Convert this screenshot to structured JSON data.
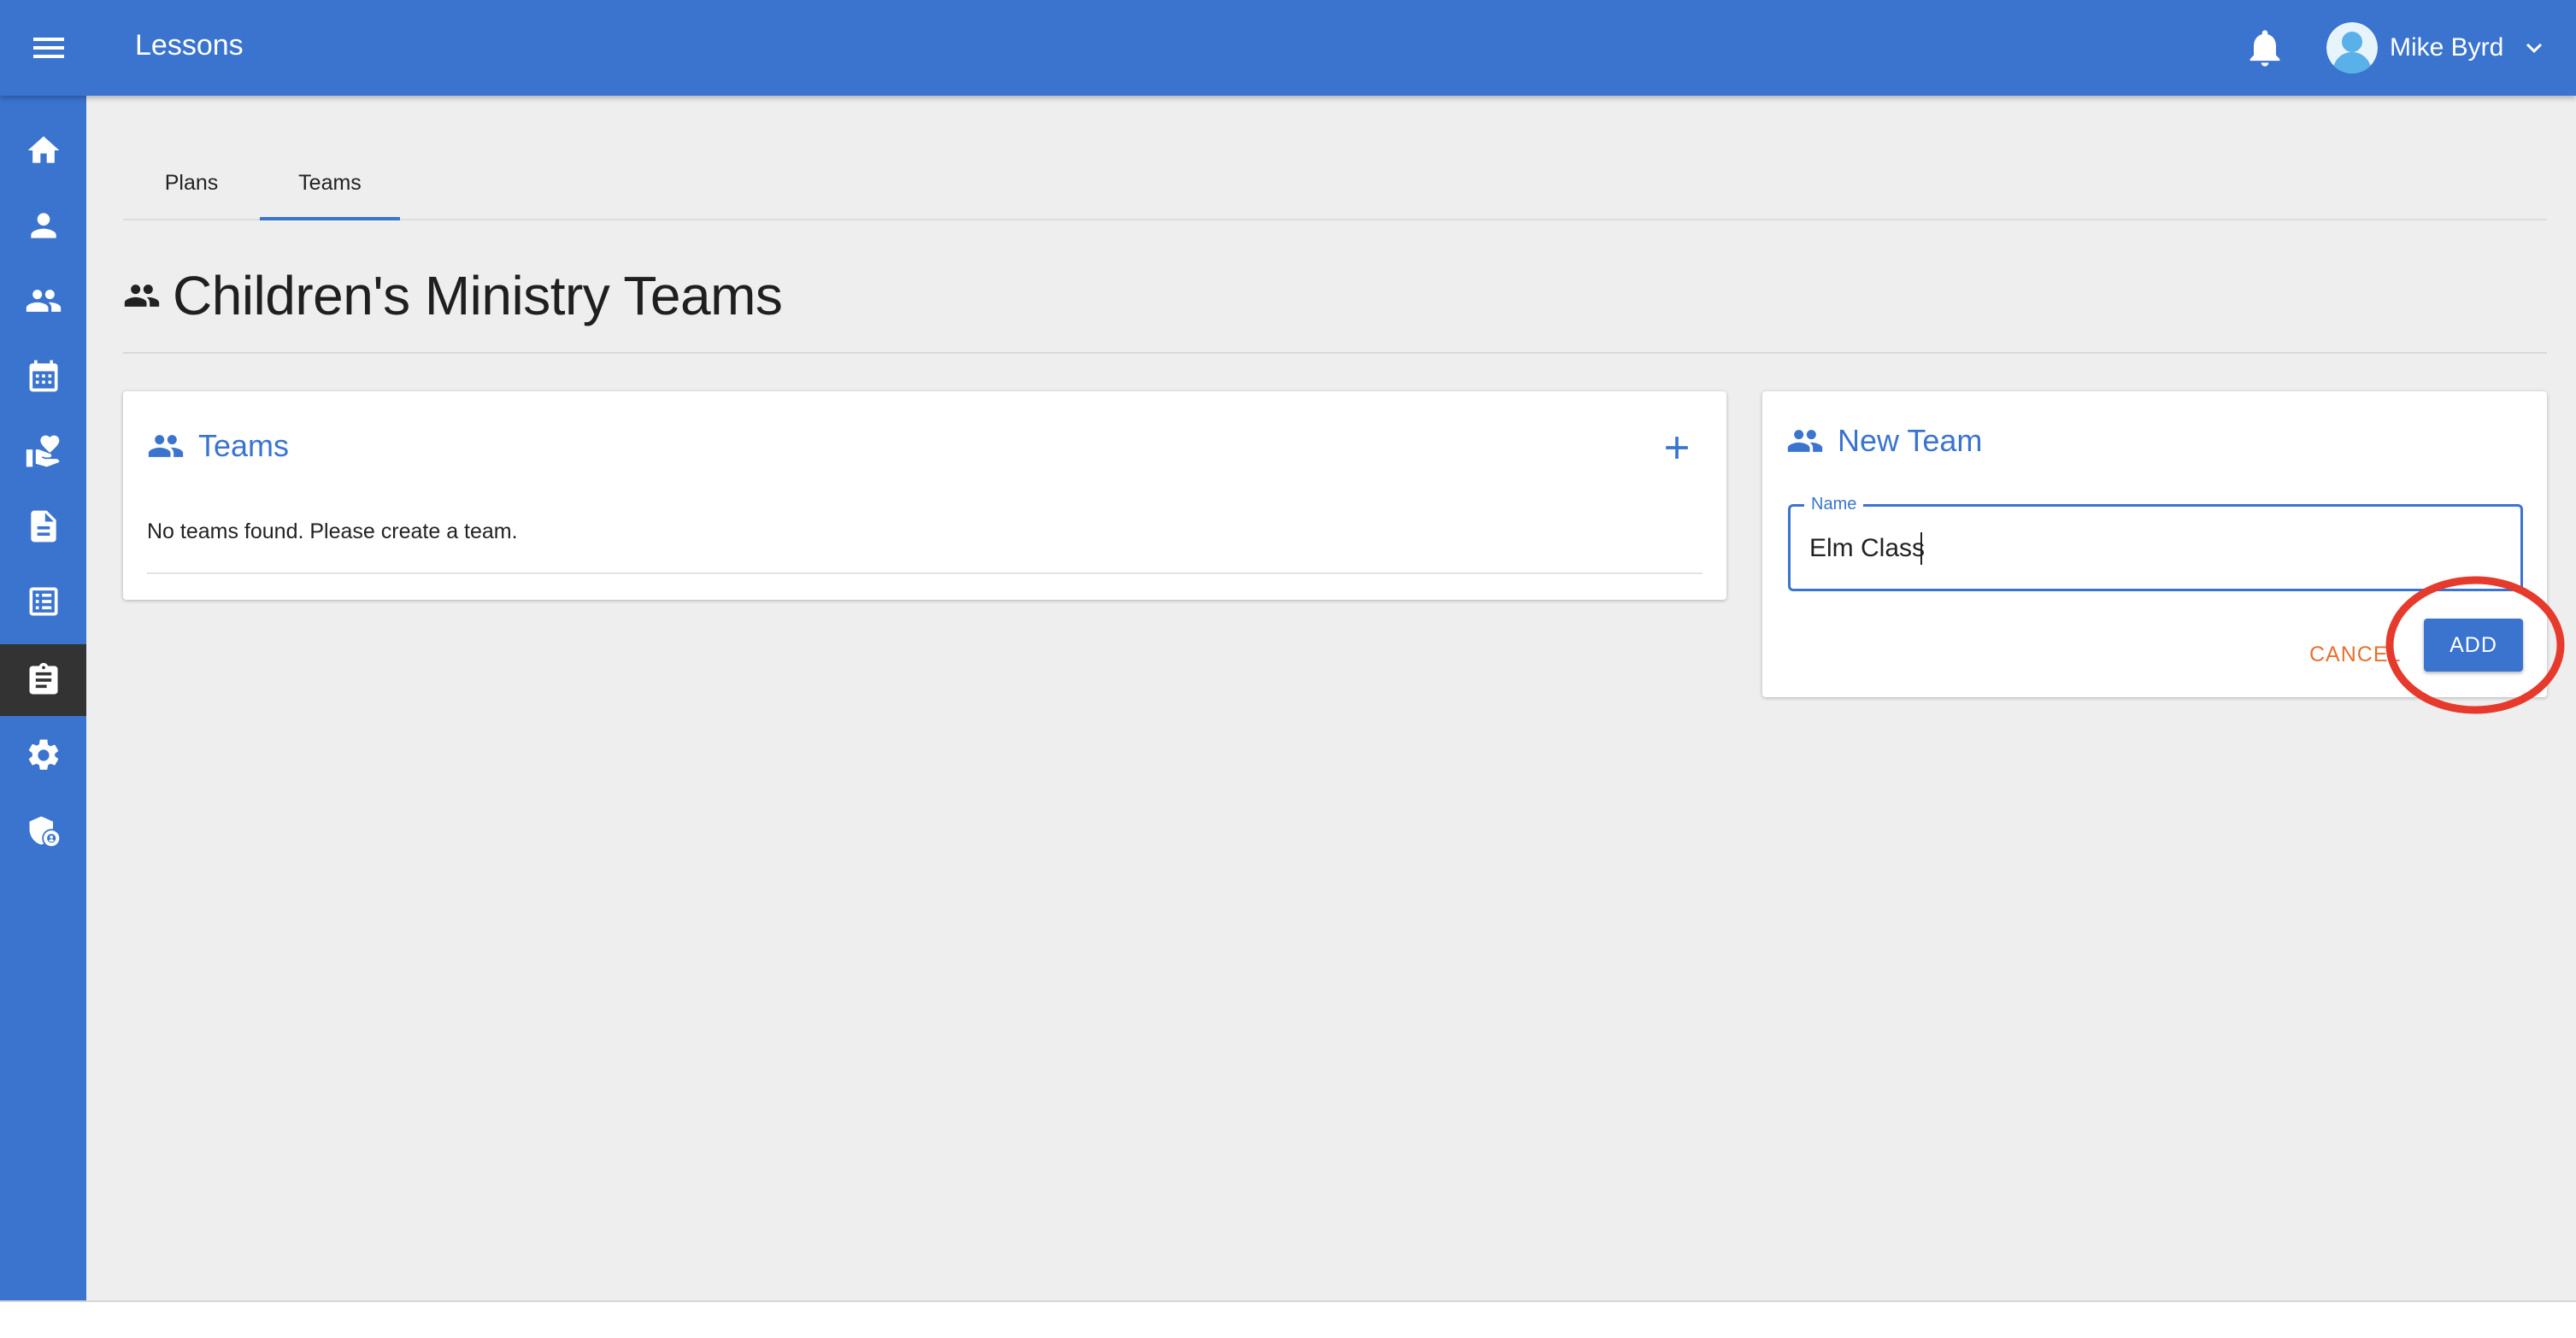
{
  "header": {
    "title": "Lessons",
    "user_name": "Mike Byrd",
    "icons": [
      "menu-icon",
      "bell-icon",
      "avatar-icon",
      "chevron-down-icon"
    ]
  },
  "sidebar": {
    "items": [
      {
        "icon": "home-icon",
        "active": false
      },
      {
        "icon": "person-icon",
        "active": false
      },
      {
        "icon": "people-icon",
        "active": false
      },
      {
        "icon": "calendar-icon",
        "active": false
      },
      {
        "icon": "donation-hand-icon",
        "active": false
      },
      {
        "icon": "document-icon",
        "active": false
      },
      {
        "icon": "list-icon",
        "active": false
      },
      {
        "icon": "clipboard-icon",
        "active": true
      },
      {
        "icon": "gear-icon",
        "active": false
      },
      {
        "icon": "shield-admin-icon",
        "active": false
      }
    ]
  },
  "tabs": [
    {
      "label": "Plans",
      "active": false
    },
    {
      "label": "Teams",
      "active": true
    }
  ],
  "page": {
    "title": "Children's Ministry Teams"
  },
  "teams_card": {
    "heading": "Teams",
    "empty_message": "No teams found. Please create a team."
  },
  "new_team_card": {
    "heading": "New Team",
    "name_label": "Name",
    "name_value": "Elm Class",
    "cancel_label": "CANCEL",
    "add_label": "ADD"
  },
  "colors": {
    "primary": "#3a74cf",
    "sidebar_active": "#333333",
    "cancel_text": "#e6712f",
    "annotation": "#e53a2c",
    "background": "#eeeeee"
  }
}
